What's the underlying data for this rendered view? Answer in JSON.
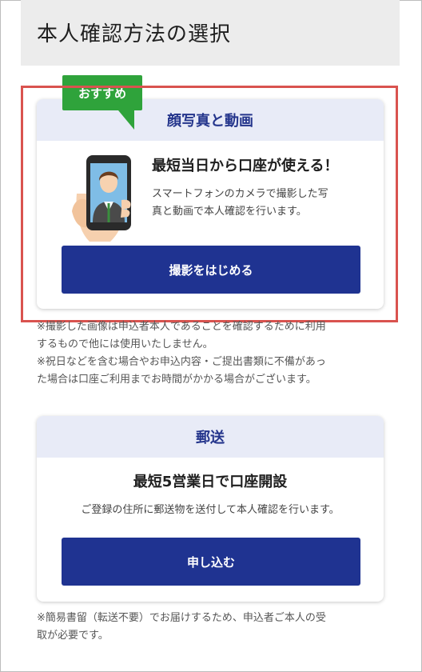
{
  "page": {
    "title": "本人確認方法の選択"
  },
  "photo_option": {
    "badge": "おすすめ",
    "heading": "顔写真と動画",
    "headline": "最短当日から口座が使える！",
    "description_lines": [
      "スマートフォンのカメラで撮影した写",
      "真と動画で本人確認を行います。"
    ],
    "button_label": "撮影をはじめる",
    "notes": [
      "※撮影した画像は申込者本人であることを確認するために利用",
      "するもので他には使用いたしません。",
      "※祝日などを含む場合やお申込内容・ご提出書類に不備があっ",
      "た場合は口座ご利用までお時間がかかる場合がございます。"
    ]
  },
  "mail_option": {
    "heading": "郵送",
    "headline": "最短5営業日で口座開設",
    "description": "ご登録の住所に郵送物を送付して本人確認を行います。",
    "button_label": "申し込む",
    "notes": [
      "※簡易書留（転送不要）でお届けするため、申込者ご本人の受",
      "取が必要です。"
    ]
  },
  "colors": {
    "accent_blue": "#1f3391",
    "badge_green": "#2fa33b",
    "highlight_red": "#d9534f",
    "card_head_bg": "#e8ebf7"
  },
  "icons": {
    "illustration": "person-in-phone-icon"
  }
}
